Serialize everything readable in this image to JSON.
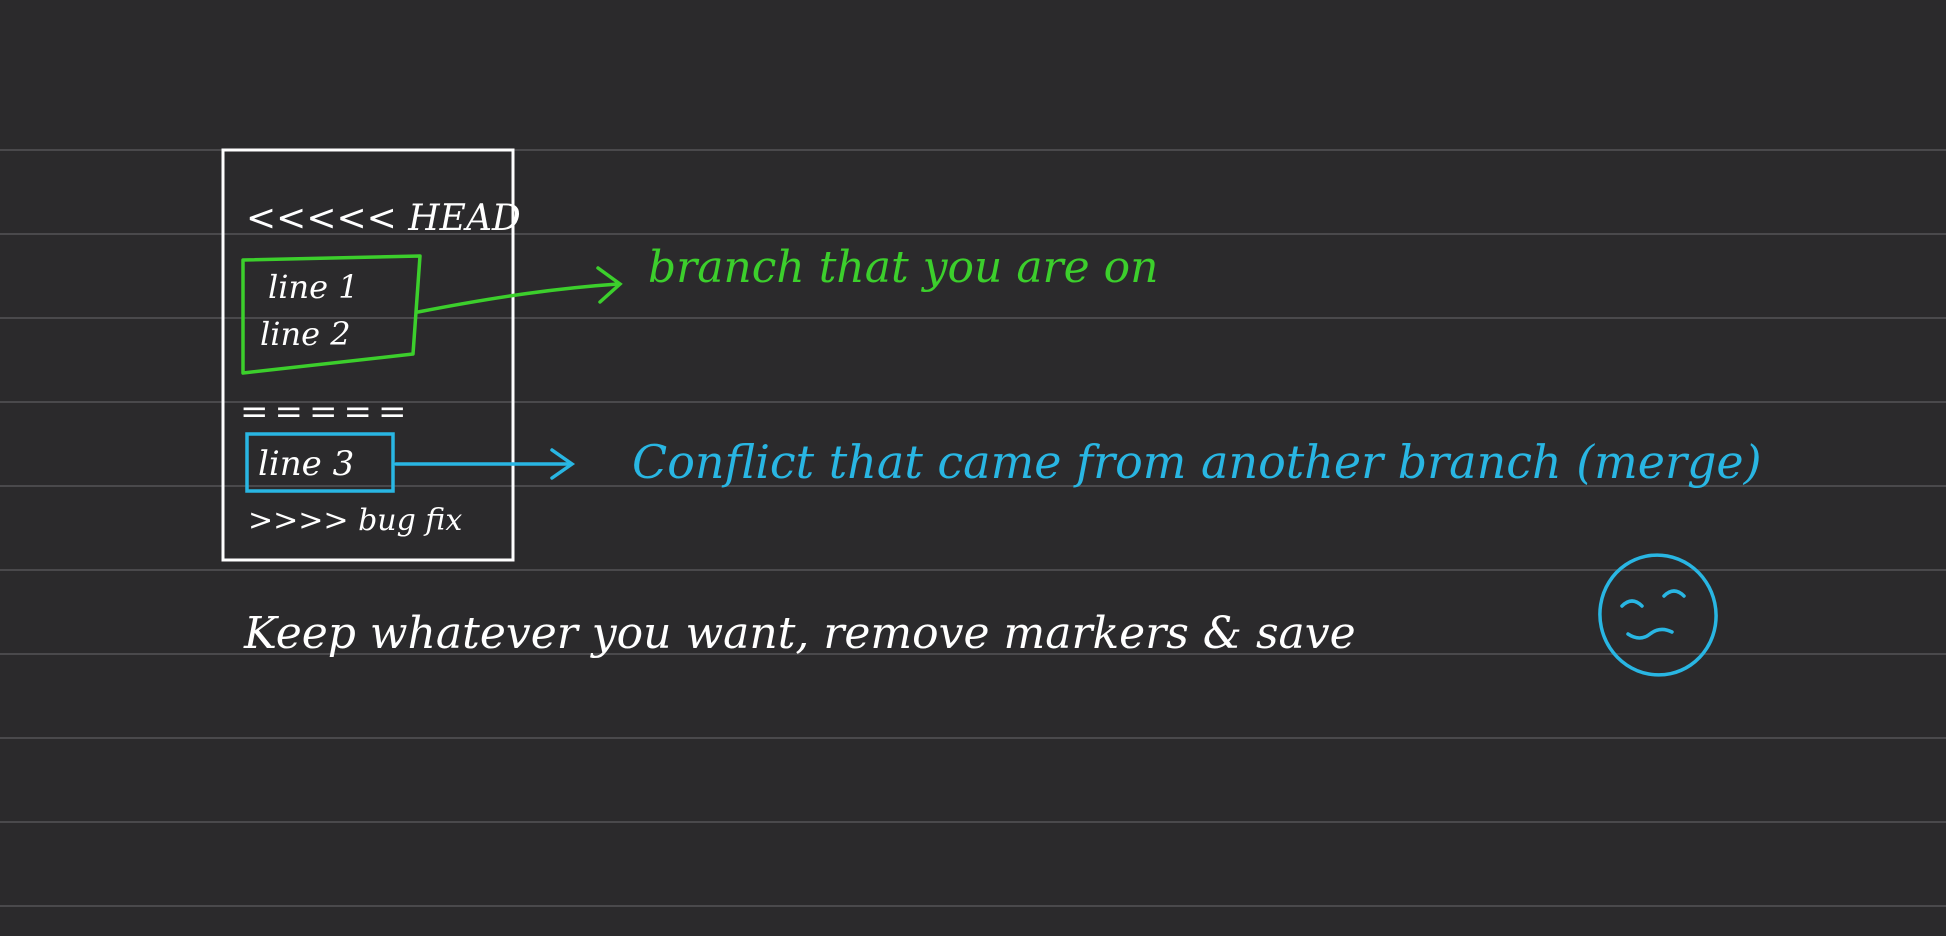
{
  "colors": {
    "background": "#2b2a2c",
    "ruled_line": "#4a494c",
    "ink_white": "#ffffff",
    "ink_green": "#3ccf2c",
    "ink_cyan": "#29b6e3"
  },
  "conflict_block": {
    "head_marker": "<<<<< HEAD",
    "current_lines": [
      "line 1",
      "line 2"
    ],
    "separator": "=====",
    "incoming_lines": [
      "line 3"
    ],
    "end_marker": ">>>> bug fix"
  },
  "annotations": {
    "current": "branch that you are on",
    "incoming": "Conflict that came from another branch (merge)"
  },
  "footer_note": "Keep whatever you want, remove markers & save",
  "icons": {
    "face": "smiling-face-icon"
  }
}
